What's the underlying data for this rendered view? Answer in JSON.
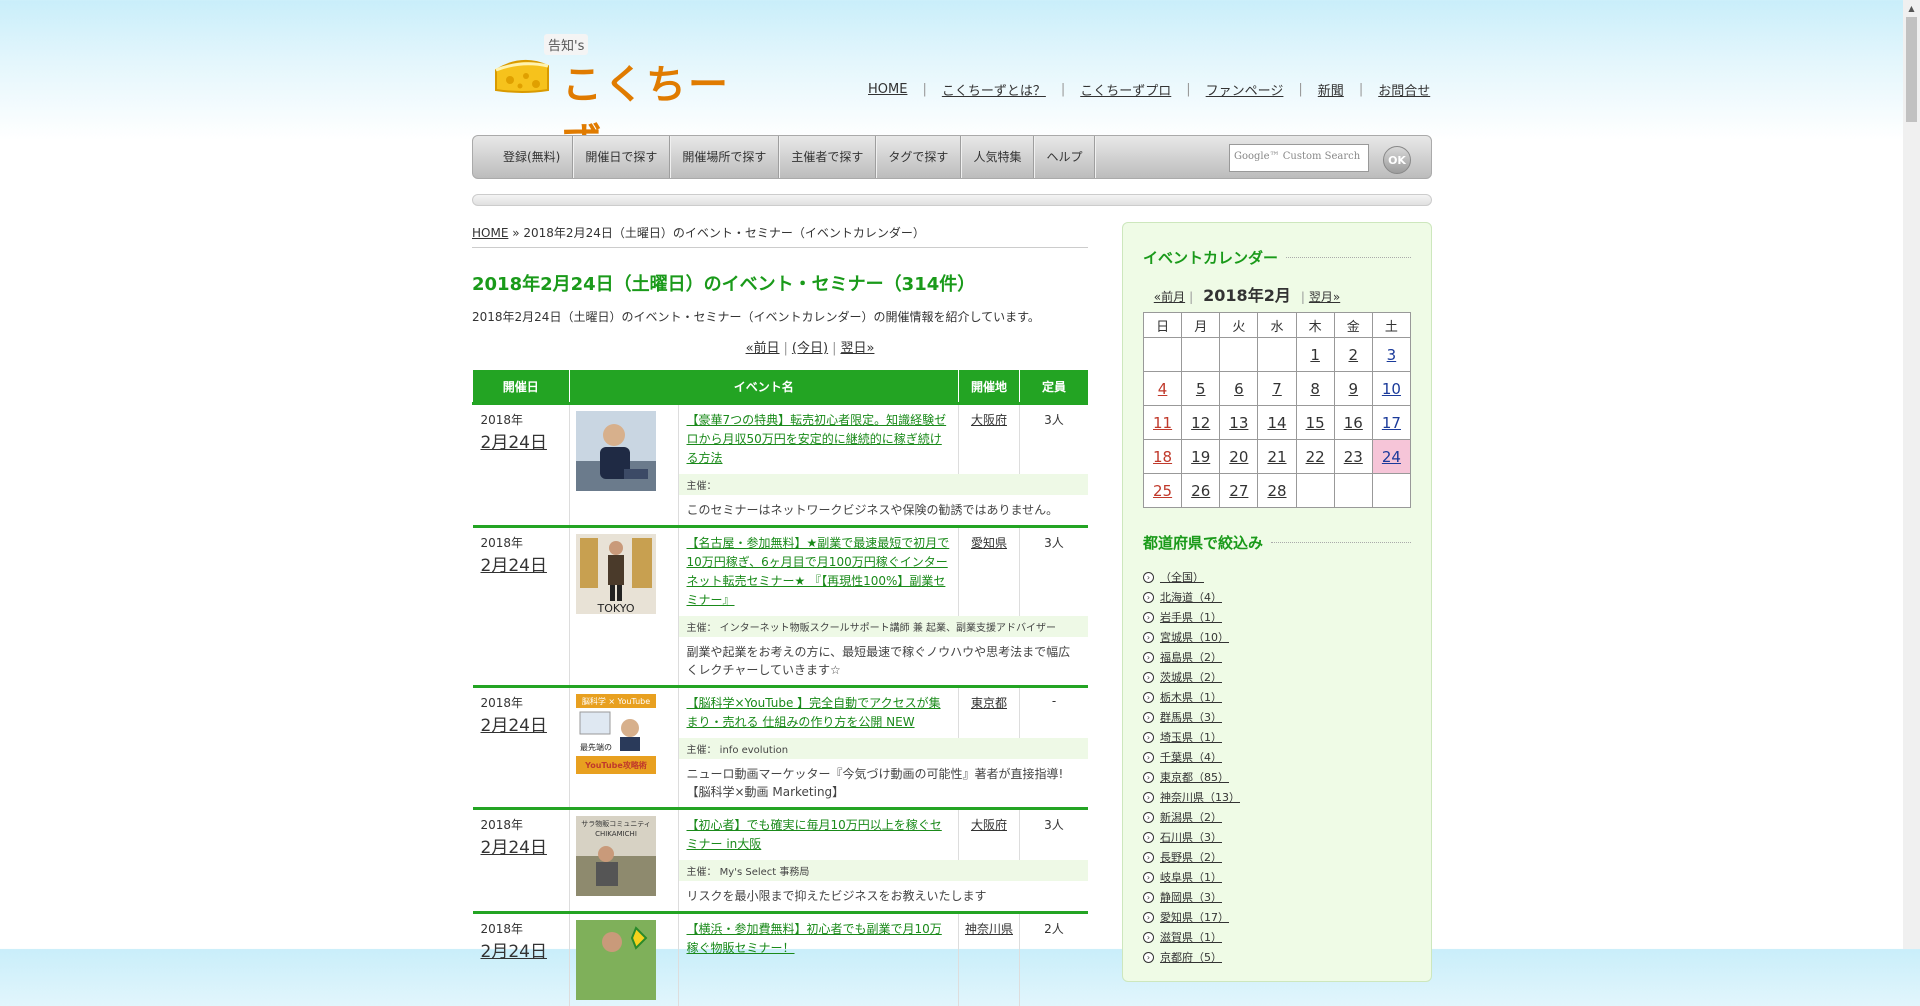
{
  "header": {
    "logo_small": "告知's",
    "logo_text": "こくちーず",
    "topnav": [
      "HOME",
      "こくちーずとは？",
      "こくちーずプロ",
      "ファンページ",
      "新聞",
      "お問合せ"
    ]
  },
  "menu": {
    "items": [
      "登録(無料)",
      "開催日で探す",
      "開催場所で探す",
      "主催者で探す",
      "タグで探す",
      "人気特集",
      "ヘルプ"
    ],
    "search_placeholder": "Google™ Custom Search",
    "ok_label": "OK"
  },
  "breadcrumb": {
    "home": "HOME",
    "sep": " » ",
    "current": "2018年2月24日（土曜日）のイベント・セミナー（イベントカレンダー）"
  },
  "main": {
    "title": "2018年2月24日（土曜日）のイベント・セミナー（314件）",
    "intro": "2018年2月24日（土曜日）のイベント・セミナー（イベントカレンダー）の開催情報を紹介しています。",
    "pager": {
      "prev": "«前日",
      "today": "(今日)",
      "next": "翌日»"
    },
    "table_headers": {
      "date": "開催日",
      "name": "イベント名",
      "place": "開催地",
      "capacity": "定員"
    }
  },
  "events": [
    {
      "year": "2018年",
      "day": "2月24日",
      "title": "【豪華7つの特典】転売初心者限定。知識経験ゼロから月収50万円を安定的に継続的に稼ぎ続ける方法",
      "place": "大阪府",
      "capacity": "3人",
      "organizer": "主催：",
      "desc": "このセミナーはネットワークビジネスや保険の勧誘ではありません。"
    },
    {
      "year": "2018年",
      "day": "2月24日",
      "title": "【名古屋・参加無料】★副業で最速最短で初月で10万円稼ぎ、6ヶ月目で月100万円稼ぐインターネット転売セミナー★ 『【再現性100%】副業セミナー』",
      "place": "愛知県",
      "capacity": "3人",
      "organizer": "主催： インターネット物販スクールサポート講師 兼 起業、副業支援アドバイザー",
      "desc": "副業や起業をお考えの方に、最短最速で稼ぐノウハウや思考法まで幅広くレクチャーしていきます☆"
    },
    {
      "year": "2018年",
      "day": "2月24日",
      "title": "【脳科学×YouTube 】完全自動でアクセスが集まり・売れる 仕組みの作り方を公開 NEW",
      "place": "東京都",
      "capacity": "-",
      "organizer": "主催： info evolution",
      "desc": "ニューロ動画マーケッター『今気づけ動画の可能性』著者が直接指導!【脳科学×動画 Marketing】"
    },
    {
      "year": "2018年",
      "day": "2月24日",
      "title": "【初心者】でも確実に毎月10万円以上を稼ぐセミナー in大阪",
      "place": "大阪府",
      "capacity": "3人",
      "organizer": "主催： My's Select 事務局",
      "desc": "リスクを最小限まで抑えたビジネスをお教えいたします"
    },
    {
      "year": "2018年",
      "day": "2月24日",
      "title": "【横浜・参加費無料】初心者でも副業で月10万稼ぐ物販セミナー！",
      "place": "神奈川県",
      "capacity": "2人",
      "organizer": "",
      "desc": ""
    }
  ],
  "thumb_labels": {
    "t2": "TOKYO",
    "t3_top": "脳科学 × YouTube",
    "t3_mid": "最先端の",
    "t3_bottom": "YouTube攻略術",
    "t4_top": "サラ物販コミュニティ",
    "t4_sub": "CHIKAMICHI"
  },
  "sidebar": {
    "calendar_title": "イベントカレンダー",
    "cal_prev": "«前月",
    "cal_current": "2018年2月",
    "cal_next": "翌月»",
    "weekdays": [
      "日",
      "月",
      "火",
      "水",
      "木",
      "金",
      "土"
    ],
    "weeks": [
      [
        "",
        "",
        "",
        "",
        "1",
        "2",
        "3"
      ],
      [
        "4",
        "5",
        "6",
        "7",
        "8",
        "9",
        "10"
      ],
      [
        "11",
        "12",
        "13",
        "14",
        "15",
        "16",
        "17"
      ],
      [
        "18",
        "19",
        "20",
        "21",
        "22",
        "23",
        "24"
      ],
      [
        "25",
        "26",
        "27",
        "28",
        "",
        "",
        ""
      ]
    ],
    "today": "24",
    "pref_title": "都道府県で絞込み",
    "prefectures": [
      "（全国）",
      "北海道（4）",
      "岩手県（1）",
      "宮城県（10）",
      "福島県（2）",
      "茨城県（2）",
      "栃木県（1）",
      "群馬県（3）",
      "埼玉県（1）",
      "千葉県（4）",
      "東京都（85）",
      "神奈川県（13）",
      "新潟県（2）",
      "石川県（3）",
      "長野県（2）",
      "岐阜県（1）",
      "静岡県（3）",
      "愛知県（17）",
      "滋賀県（1）",
      "京都府（5）"
    ]
  },
  "colors": {
    "accent_green": "#23a423",
    "title_green": "#1a9a1a",
    "logo_orange": "#e07b00",
    "today_pink": "#f6c5d8"
  }
}
